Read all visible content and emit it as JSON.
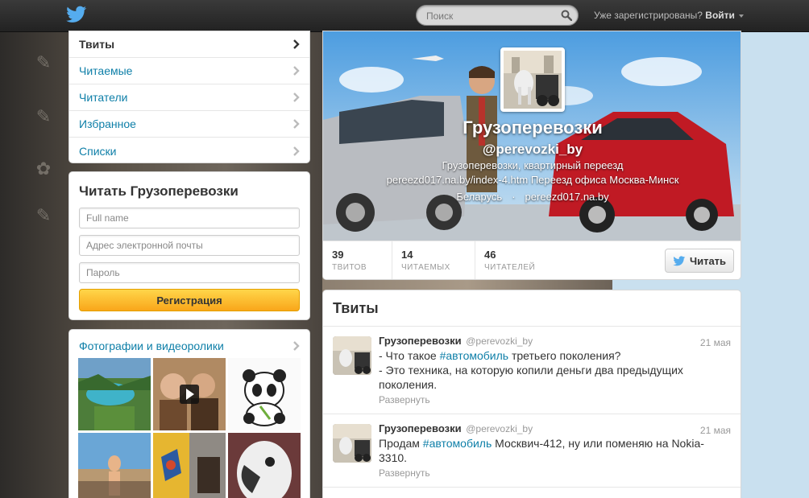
{
  "topbar": {
    "search_placeholder": "Поиск",
    "signin_prefix": "Уже зарегистрированы?",
    "signin_link": "Войти"
  },
  "nav": {
    "items": [
      {
        "label": "Твиты"
      },
      {
        "label": "Читаемые"
      },
      {
        "label": "Читатели"
      },
      {
        "label": "Избранное"
      },
      {
        "label": "Списки"
      }
    ]
  },
  "signup": {
    "title": "Читать Грузоперевозки",
    "fullname_placeholder": "Full name",
    "email_placeholder": "Адрес электронной почты",
    "password_placeholder": "Пароль",
    "button": "Регистрация"
  },
  "media": {
    "title": "Фотографии и видеоролики"
  },
  "profile": {
    "name": "Грузоперевозки",
    "handle": "@perevozki_by",
    "bio_line1": "Грузоперевозки, квартирный переезд",
    "bio_line2": "pereezd017.na.by/index-4.htm Переезд офиса Москва-Минск",
    "location": "Беларусь",
    "separator": "·",
    "website": "pereezd017.na.by",
    "stats": [
      {
        "value": "39",
        "label": "ТВИТОВ"
      },
      {
        "value": "14",
        "label": "ЧИТАЕМЫХ"
      },
      {
        "value": "46",
        "label": "ЧИТАТЕЛЕЙ"
      }
    ],
    "follow_button": "Читать"
  },
  "tweets": {
    "heading": "Твиты",
    "items": [
      {
        "name": "Грузоперевозки",
        "handle": "@perevozki_by",
        "date": "21 мая",
        "text_1": "- Что такое ",
        "hashtag": "#автомобиль",
        "text_2": " третьего поколения?",
        "text_3": " - Это техника, на которую копили деньги два предыдущих поколения.",
        "expand": "Развернуть"
      },
      {
        "name": "Грузоперевозки",
        "handle": "@perevozki_by",
        "date": "21 мая",
        "text_1": "Продам ",
        "hashtag": "#автомобиль",
        "text_2": " Москвич-412, ну или поменяю на Nokia-3310.",
        "text_3": "",
        "expand": "Развернуть"
      }
    ]
  },
  "colors": {
    "link": "#0e7fa8",
    "button_yellow": "#f9a61a",
    "topbar": "#2a2a2a"
  }
}
